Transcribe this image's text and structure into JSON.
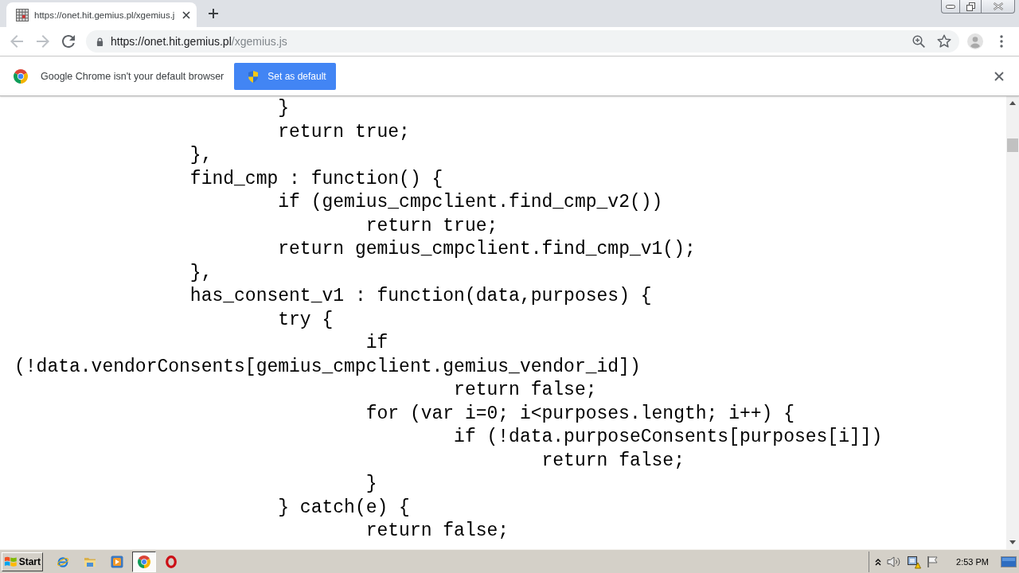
{
  "tabs": [
    {
      "title": "https://onet.hit.gemius.pl/xgemius.j",
      "selected": true
    }
  ],
  "toolbar": {
    "nav": [
      {
        "kind": "back",
        "disabled": true
      },
      {
        "kind": "forward",
        "disabled": true
      },
      {
        "kind": "reload",
        "disabled": false
      }
    ],
    "url": {
      "host": "https://onet.hit.gemius.pl",
      "path": "/xgemius.js"
    }
  },
  "infobar": {
    "message": "Google Chrome isn't your default browser",
    "button": "Set as default"
  },
  "code_lines": [
    "\t\t\t}",
    "\t\t\treturn true;",
    "\t\t},",
    "\t\tfind_cmp : function() {",
    "\t\t\tif (gemius_cmpclient.find_cmp_v2())",
    "\t\t\t\treturn true;",
    "\t\t\treturn gemius_cmpclient.find_cmp_v1();",
    "\t\t},",
    "\t\thas_consent_v1 : function(data,purposes) {",
    "\t\t\ttry {",
    "\t\t\t\tif (!data.vendorConsents[gemius_cmpclient.gemius_vendor_id])",
    "\t\t\t\t\treturn false;",
    "\t\t\t\tfor (var i=0; i<purposes.length; i++) {",
    "\t\t\t\t\tif (!data.purposeConsents[purposes[i]])",
    "\t\t\t\t\t\treturn false;",
    "\t\t\t\t}",
    "\t\t\t} catch(e) {",
    "\t\t\t\treturn false;"
  ],
  "taskbar": {
    "start": "Start",
    "apps": [
      {
        "kind": "ie",
        "selected": false
      },
      {
        "kind": "folder",
        "selected": false
      },
      {
        "kind": "media",
        "selected": false
      },
      {
        "kind": "chrome",
        "selected": true
      },
      {
        "kind": "opera",
        "selected": false
      }
    ],
    "clock": "2:53 PM"
  }
}
